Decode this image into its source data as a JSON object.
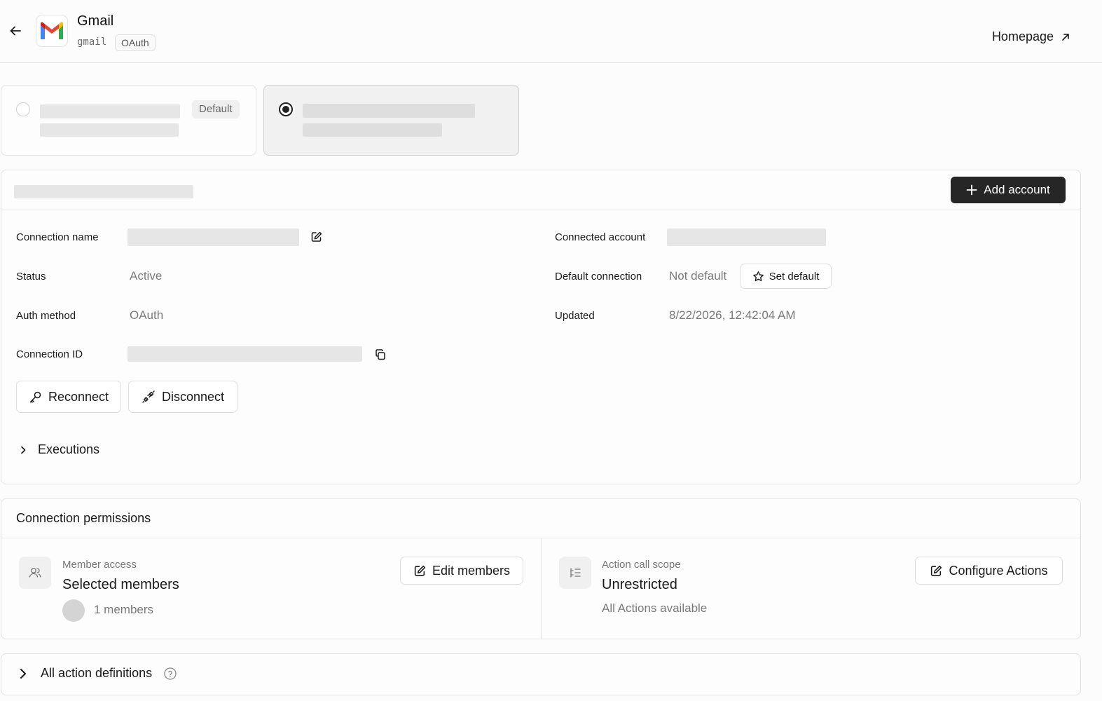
{
  "header": {
    "app_name": "Gmail",
    "app_slug": "gmail",
    "auth_badge": "OAuth",
    "homepage_label": "Homepage"
  },
  "account_cards": [
    {
      "badge": "Default",
      "selected": false
    },
    {
      "badge": "",
      "selected": true
    }
  ],
  "connection": {
    "add_account_label": "Add account",
    "connection_name_label": "Connection name",
    "status_label": "Status",
    "status_value": "Active",
    "auth_method_label": "Auth method",
    "auth_method_value": "OAuth",
    "connection_id_label": "Connection ID",
    "connected_account_label": "Connected account",
    "default_connection_label": "Default connection",
    "default_connection_value": "Not default",
    "set_default_label": "Set default",
    "updated_label": "Updated",
    "updated_value": "8/22/2026, 12:42:04 AM",
    "reconnect_label": "Reconnect",
    "disconnect_label": "Disconnect",
    "executions_label": "Executions"
  },
  "permissions": {
    "title": "Connection permissions",
    "member_access_label": "Member access",
    "member_access_value": "Selected members",
    "member_count": "1 members",
    "edit_members_label": "Edit members",
    "action_scope_label": "Action call scope",
    "action_scope_value": "Unrestricted",
    "action_scope_note": "All Actions available",
    "configure_actions_label": "Configure Actions"
  },
  "definitions": {
    "label": "All action definitions"
  },
  "colors": {
    "primary_button": "#262626",
    "muted_text": "#7a7a7a",
    "skeleton": "#e6e6e6"
  }
}
